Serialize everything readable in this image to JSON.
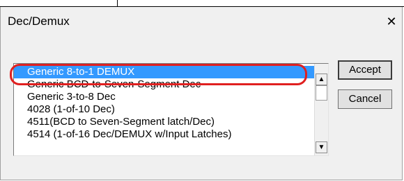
{
  "window": {
    "title": "Dec/Demux",
    "close_glyph": "✕"
  },
  "listbox": {
    "items": [
      "Generic 8-to-1 DEMUX",
      "Generic BCD-to-Seven-Segment Dec",
      "Generic 3-to-8 Dec",
      "4028 (1-of-10 Dec)",
      "4511(BCD to Seven-Segment latch/Dec)",
      "4514 (1-of-16 Dec/DEMUX w/Input Latches)"
    ],
    "selected_index": 0,
    "scroll_up_icon": "▲",
    "scroll_down_icon": "▼"
  },
  "buttons": {
    "accept_label": "Accept",
    "cancel_label": "Cancel"
  },
  "colors": {
    "selection": "#3399ff",
    "highlight_ring": "#e02020",
    "dialog_bg": "#f0f0f0"
  }
}
